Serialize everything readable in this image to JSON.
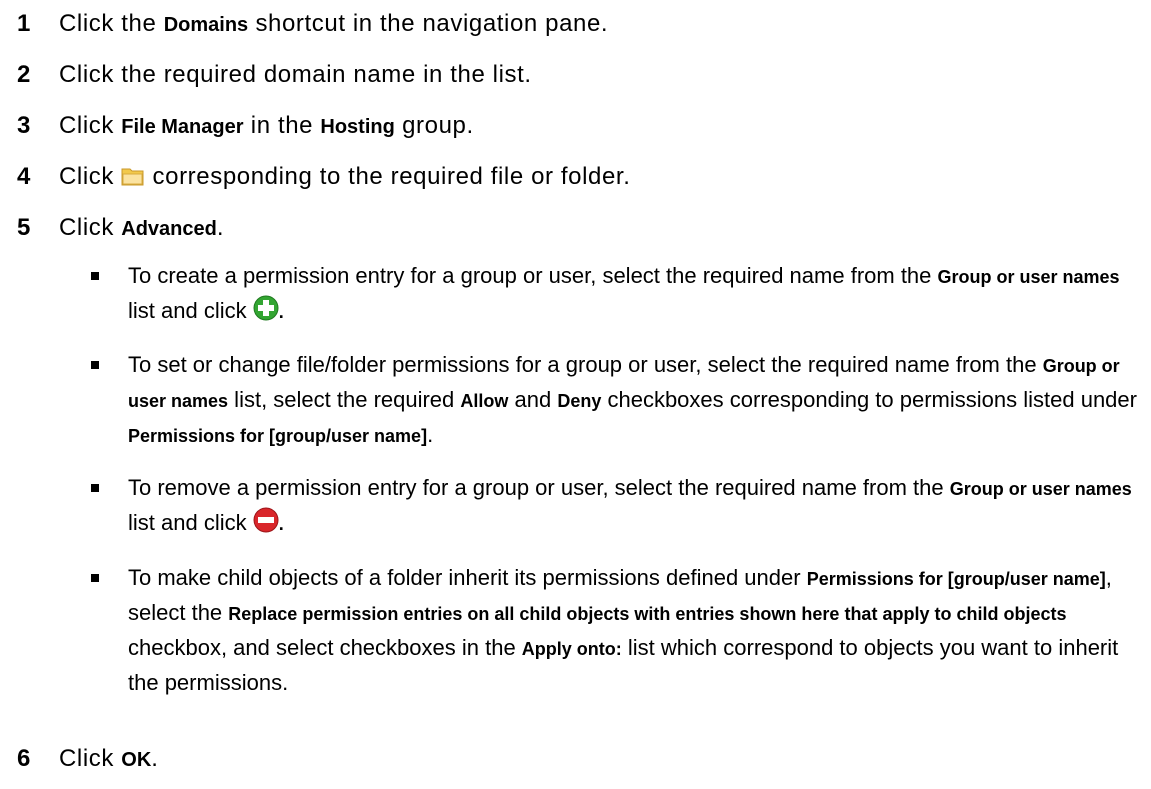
{
  "steps": [
    {
      "number": "1",
      "prefix": "Click the ",
      "kw1": "Domains",
      "suffix": " shortcut in the navigation pane."
    },
    {
      "number": "2",
      "text": "Click the required domain name in the list."
    },
    {
      "number": "3",
      "prefix": "Click ",
      "kw1": "File Manager",
      "mid": " in the ",
      "kw2": "Hosting",
      "suffix": " group."
    },
    {
      "number": "4",
      "prefix": "Click ",
      "icon": "folder-icon",
      "suffix": " corresponding to the required file or folder."
    },
    {
      "number": "5",
      "prefix": "Click ",
      "kw1": "Advanced",
      "suffix": "."
    },
    {
      "number": "6",
      "prefix": "Click ",
      "kw1": "OK",
      "suffix": "."
    }
  ],
  "bullets": [
    {
      "t1": "To create a permission entry for a group or user, select the required name from the ",
      "k1": "Group or user names",
      "t2": " list and click ",
      "icon": "add-icon",
      "t3": "."
    },
    {
      "t1": "To set or change file/folder permissions for a group or user, select the required name from the ",
      "k1": "Group or user names",
      "t2": " list, select the required ",
      "k2": "Allow",
      "t3": " and ",
      "k3": "Deny",
      "t4": " checkboxes corresponding to permissions listed under ",
      "k4": "Permissions for [group/user name]",
      "t5": "."
    },
    {
      "t1": "To remove a permission entry for a group or user, select the required name from the ",
      "k1": "Group or user names",
      "t2": " list and click ",
      "icon": "remove-icon",
      "t3": "."
    },
    {
      "t1": "To make child objects of a folder inherit its permissions defined under ",
      "k1": "Permissions for [group/user name]",
      "t2": ", select the ",
      "k2": "Replace permission entries on all child objects with entries shown here that apply to child objects",
      "t3": " checkbox, and select checkboxes in the ",
      "k3": "Apply onto:",
      "t4": " list which correspond to objects you want to inherit the permissions."
    }
  ],
  "colors": {
    "text": "#000000",
    "folder_icon": "#f2c94c",
    "add_icon": "#33a532",
    "remove_icon": "#d9262b"
  }
}
